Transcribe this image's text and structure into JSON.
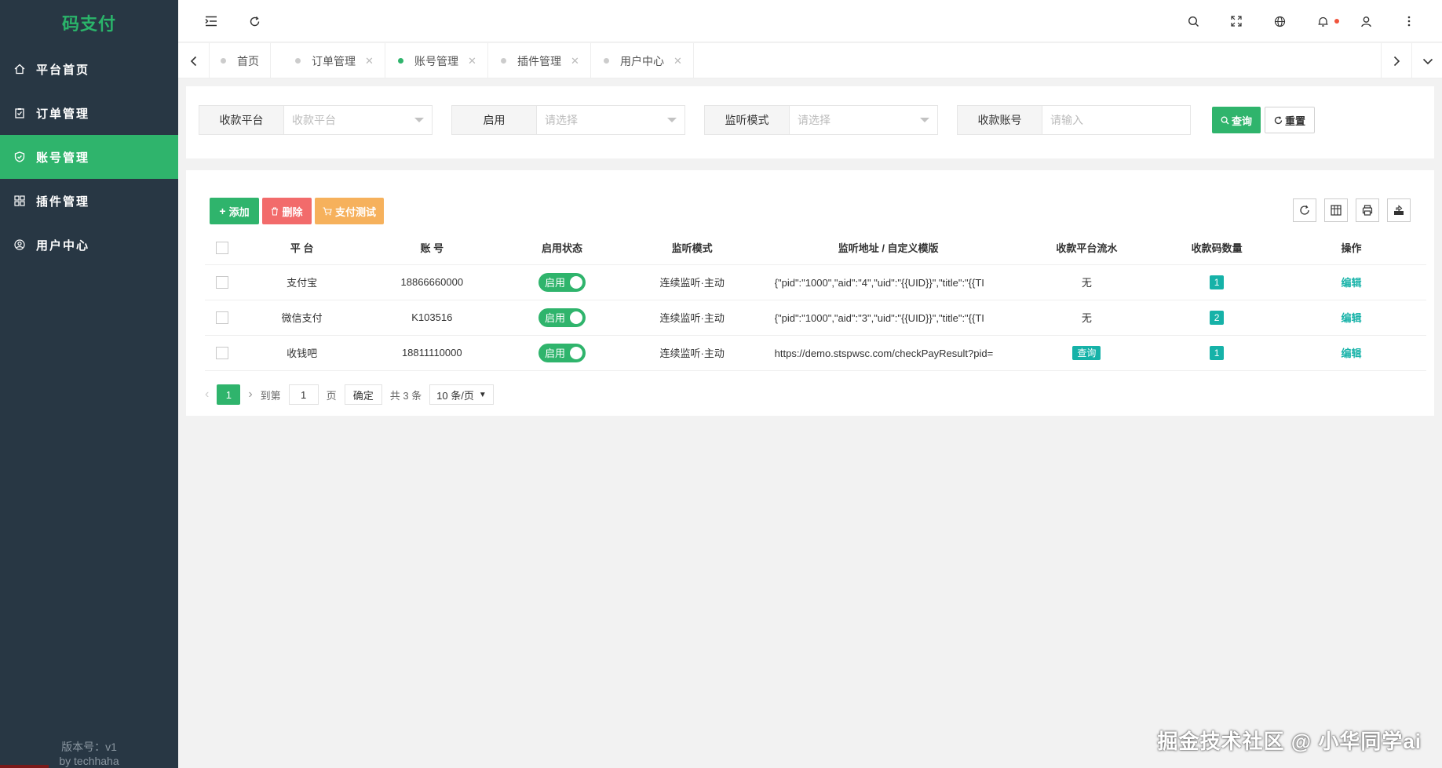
{
  "app": {
    "logo": "码支付",
    "version": "版本号：v1",
    "author": "by techhaha"
  },
  "sidebar": {
    "items": [
      {
        "label": "平台首页",
        "icon": "home-icon"
      },
      {
        "label": "订单管理",
        "icon": "clipboard-check-icon"
      },
      {
        "label": "账号管理",
        "icon": "shield-check-icon",
        "active": true
      },
      {
        "label": "插件管理",
        "icon": "grid-icon"
      },
      {
        "label": "用户中心",
        "icon": "user-circle-icon"
      }
    ]
  },
  "tabs": [
    {
      "label": "首页",
      "closable": false
    },
    {
      "label": "订单管理",
      "closable": true
    },
    {
      "label": "账号管理",
      "closable": true,
      "active": true
    },
    {
      "label": "插件管理",
      "closable": true
    },
    {
      "label": "用户中心",
      "closable": true
    }
  ],
  "search": {
    "platform": {
      "label": "收款平台",
      "placeholder": "收款平台"
    },
    "enabled": {
      "label": "启用",
      "placeholder": "请选择"
    },
    "mode": {
      "label": "监听模式",
      "placeholder": "请选择"
    },
    "account": {
      "label": "收款账号",
      "placeholder": "请输入"
    },
    "query_label": "查询",
    "reset_label": "重置"
  },
  "toolbar": {
    "add_label": "添加",
    "delete_label": "删除",
    "paytest_label": "支付测试"
  },
  "table": {
    "columns": [
      "平 台",
      "账 号",
      "启用状态",
      "监听模式",
      "监听地址 / 自定义模版",
      "收款平台流水",
      "收款码数量",
      "操作"
    ],
    "rows": [
      {
        "platform": "支付宝",
        "account": "18866660000",
        "status": "启用",
        "mode": "连续监听·主动",
        "template": "{\"pid\":\"1000\",\"aid\":\"4\",\"uid\":\"{{UID}}\",\"title\":\"{{TI",
        "flow": "无",
        "codes": "1",
        "action": "编辑"
      },
      {
        "platform": "微信支付",
        "account": "K103516",
        "status": "启用",
        "mode": "连续监听·主动",
        "template": "{\"pid\":\"1000\",\"aid\":\"3\",\"uid\":\"{{UID}}\",\"title\":\"{{TI",
        "flow": "无",
        "codes": "2",
        "action": "编辑"
      },
      {
        "platform": "收钱吧",
        "account": "18811110000",
        "status": "启用",
        "mode": "连续监听·主动",
        "template": "https://demo.stspwsc.com/checkPayResult?pid=",
        "flow": "查询",
        "codes": "1",
        "action": "编辑"
      }
    ]
  },
  "pager": {
    "current": "1",
    "goto_label": "到第",
    "goto_value": "1",
    "page_label": "页",
    "confirm_label": "确定",
    "total": "共 3 条",
    "page_size": "10 条/页"
  },
  "watermark": "掘金技术社区 @ 小华同学ai",
  "colors": {
    "primary": "#2fb46c",
    "sidebar": "#283744",
    "danger": "#f26b6b",
    "warning": "#f6b15c",
    "teal": "#16b2a8"
  }
}
